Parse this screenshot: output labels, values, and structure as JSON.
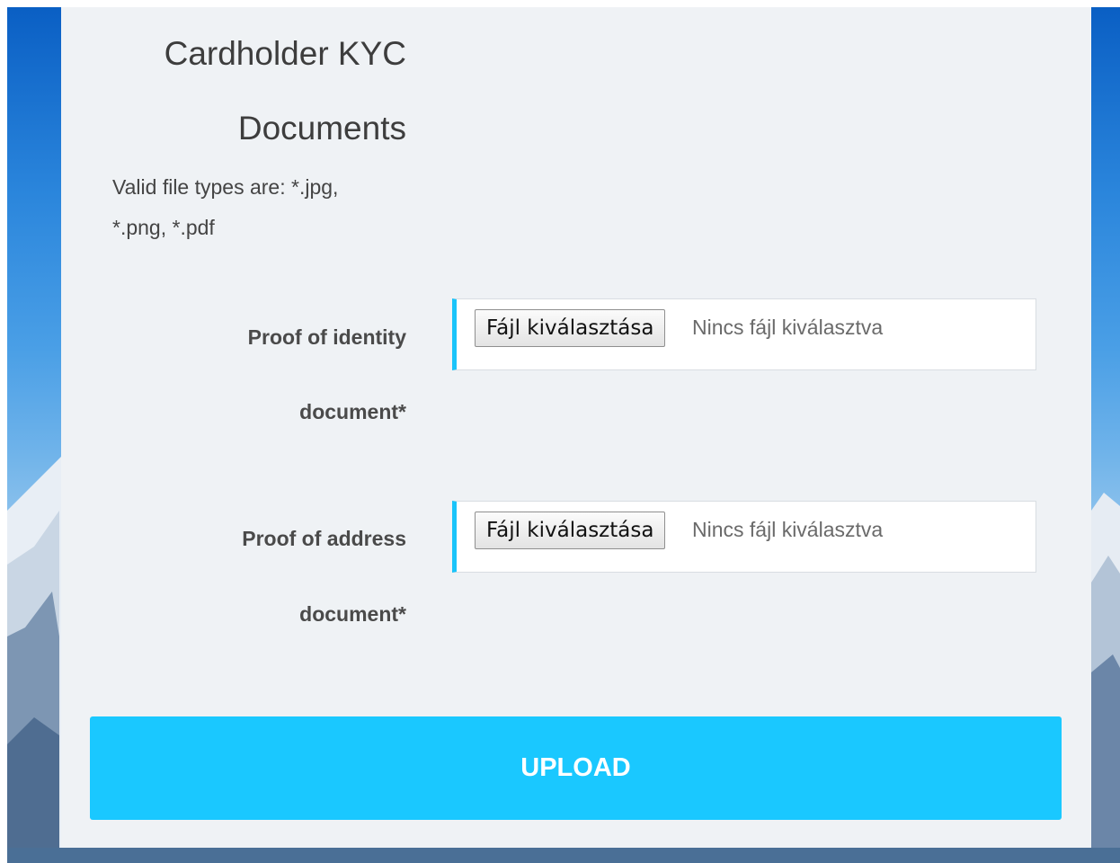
{
  "form": {
    "title_line1": "Cardholder KYC",
    "title_line2": "Documents",
    "hint_line1": "Valid file types are: *.jpg,",
    "hint_line2": "*.png, *.pdf",
    "fields": [
      {
        "label_line1": "Proof of identity",
        "label_line2": "document*",
        "button_label": "Fájl kiválasztása",
        "status": "Nincs fájl kiválasztva"
      },
      {
        "label_line1": "Proof of address",
        "label_line2": "document*",
        "button_label": "Fájl kiválasztása",
        "status": "Nincs fájl kiválasztva"
      }
    ],
    "submit_label": "UPLOAD"
  },
  "colors": {
    "accent": "#1ac8ff",
    "card_background": "#eff2f5",
    "text": "#3d3d3d"
  }
}
